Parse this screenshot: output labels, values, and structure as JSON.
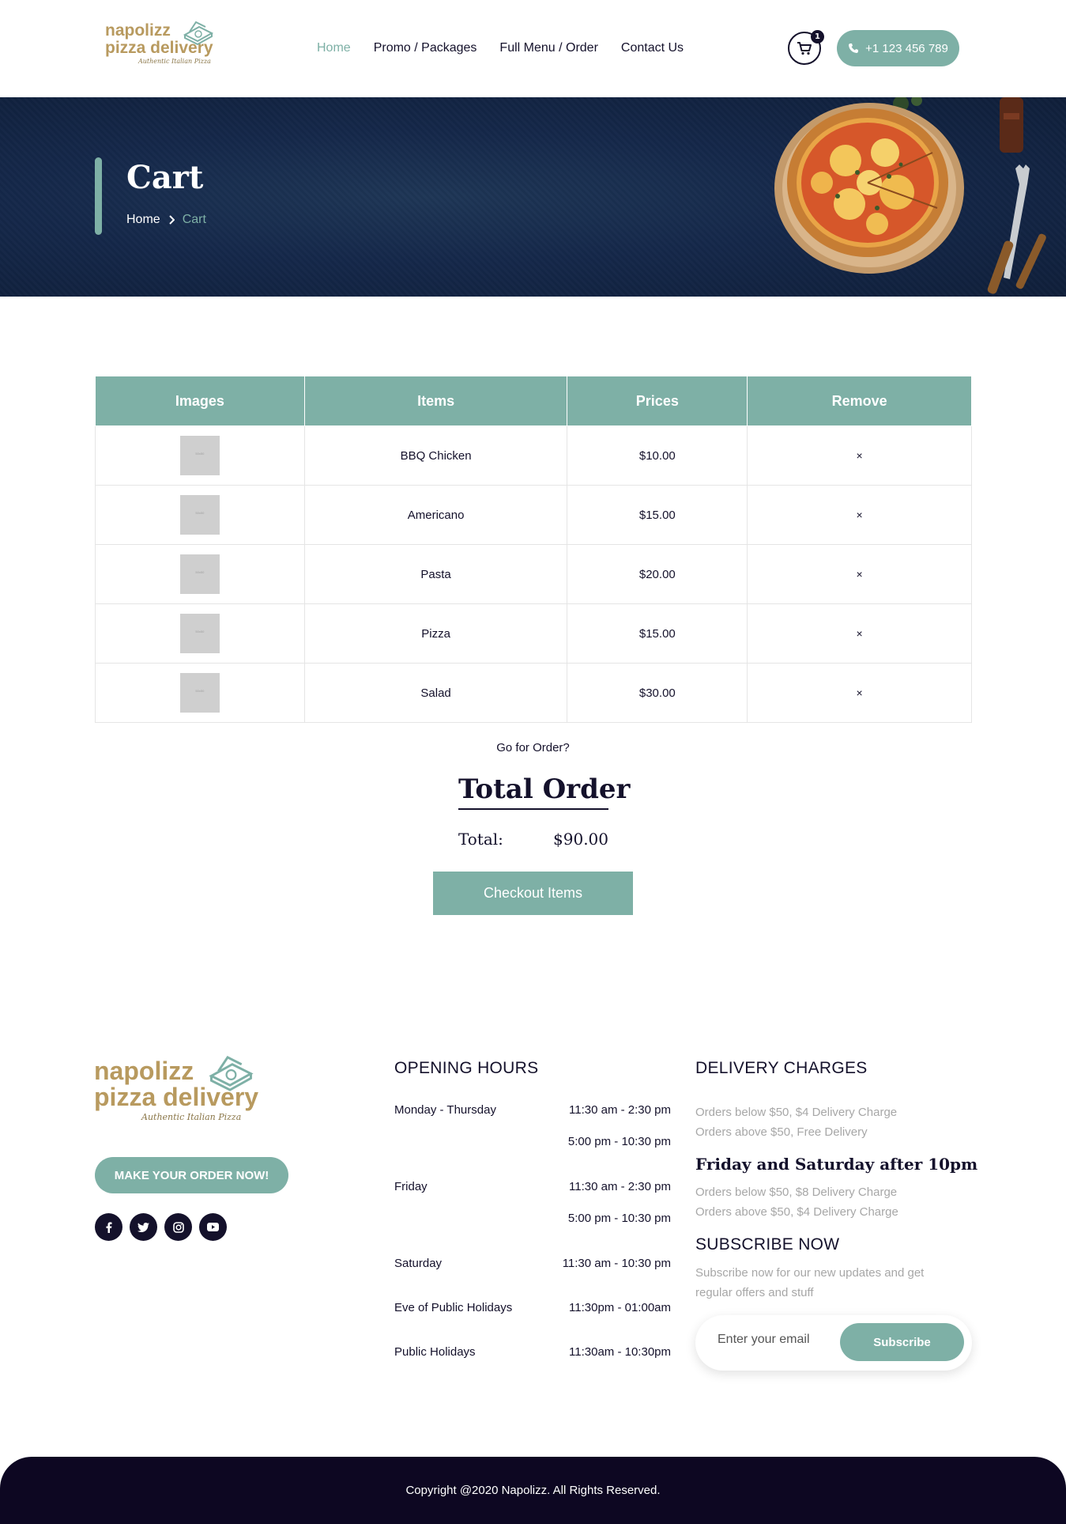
{
  "brand": {
    "name_line1": "napolizz",
    "name_line2": "pizza delivery",
    "tagline": "Authentic Italian Pizza"
  },
  "nav": {
    "items": [
      {
        "label": "Home",
        "active": true
      },
      {
        "label": "Promo / Packages",
        "active": false
      },
      {
        "label": "Full Menu / Order",
        "active": false
      },
      {
        "label": "Contact Us",
        "active": false
      }
    ],
    "cart_count": "1",
    "phone": "+1 123 456 789"
  },
  "hero": {
    "title": "Cart",
    "breadcrumb": {
      "home": "Home",
      "current": "Cart"
    }
  },
  "cart": {
    "headers": [
      "Images",
      "Items",
      "Prices",
      "Remove"
    ],
    "rows": [
      {
        "item": "BBQ Chicken",
        "price": "$10.00",
        "remove": "×"
      },
      {
        "item": "Americano",
        "price": "$15.00",
        "remove": "×"
      },
      {
        "item": "Pasta",
        "price": "$20.00",
        "remove": "×"
      },
      {
        "item": "Pizza",
        "price": "$15.00",
        "remove": "×"
      },
      {
        "item": "Salad",
        "price": "$30.00",
        "remove": "×"
      }
    ]
  },
  "order": {
    "prompt": "Go for Order?",
    "title": "Total Order",
    "total_label": "Total:",
    "total_value": "$90.00",
    "checkout_label": "Checkout Items"
  },
  "footer": {
    "make_order_label": "MAKE YOUR ORDER NOW!",
    "opening_title": "OPENING HOURS",
    "hours": [
      {
        "day": "Monday - Thursday",
        "times": [
          "11:30 am - 2:30 pm",
          "5:00 pm - 10:30 pm"
        ]
      },
      {
        "day": "Friday",
        "times": [
          "11:30 am - 2:30 pm",
          "5:00 pm - 10:30 pm"
        ]
      },
      {
        "day": "Saturday",
        "times": [
          "11:30 am - 10:30 pm"
        ]
      },
      {
        "day": "Eve of Public Holidays",
        "times": [
          "11:30pm - 01:00am"
        ]
      },
      {
        "day": "Public Holidays",
        "times": [
          "11:30am - 10:30pm"
        ]
      }
    ],
    "delivery_title": "DELIVERY CHARGES",
    "delivery_lines": [
      "Orders below $50, $4 Delivery Charge",
      "Orders above $50, Free Delivery"
    ],
    "weekend_title": "Friday and Saturday after 10pm",
    "weekend_lines": [
      "Orders below $50, $8 Delivery Charge",
      "Orders above $50, $4 Delivery Charge"
    ],
    "subscribe_title": "SUBSCRIBE NOW",
    "subscribe_text_line1": "Subscribe now for our new updates and get",
    "subscribe_text_line2": "regular offers and stuff",
    "email_placeholder": "Enter your email",
    "subscribe_label": "Subscribe",
    "copyright": "Copyright @2020 Napolizz. All Rights Reserved."
  },
  "colors": {
    "accent": "#7eb0a6",
    "dark": "#14112b",
    "gold": "#b89a5f",
    "hero_bg": "#15284a",
    "footer_bar": "#0d0722"
  },
  "icons": [
    "pizza-box-icon",
    "cart-icon",
    "phone-icon",
    "chevron-right-icon",
    "facebook-icon",
    "twitter-icon",
    "instagram-icon",
    "youtube-icon"
  ]
}
